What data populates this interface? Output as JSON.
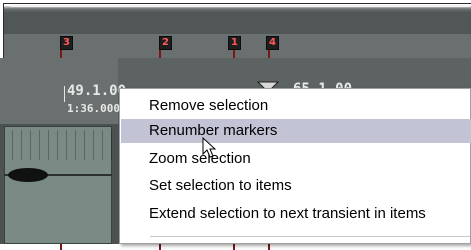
{
  "markers": [
    {
      "label": "3"
    },
    {
      "label": "2"
    },
    {
      "label": "1"
    },
    {
      "label": "4"
    }
  ],
  "ruler": {
    "measure_left": "49.1.00",
    "time_left": "1:36.000",
    "measure_right": "65.1.00"
  },
  "context_menu": {
    "items": [
      {
        "label": "Remove selection",
        "highlighted": false
      },
      {
        "label": "Renumber markers",
        "highlighted": true
      },
      {
        "label": "Zoom selection",
        "highlighted": false
      },
      {
        "label": "Set selection to items",
        "highlighted": false
      },
      {
        "label": "Extend selection to next transient in items",
        "highlighted": false
      }
    ]
  },
  "colors": {
    "marker_text": "#ff5a5a",
    "menu_highlight": "#c3c3d6",
    "item_fill": "#7a8b86"
  }
}
